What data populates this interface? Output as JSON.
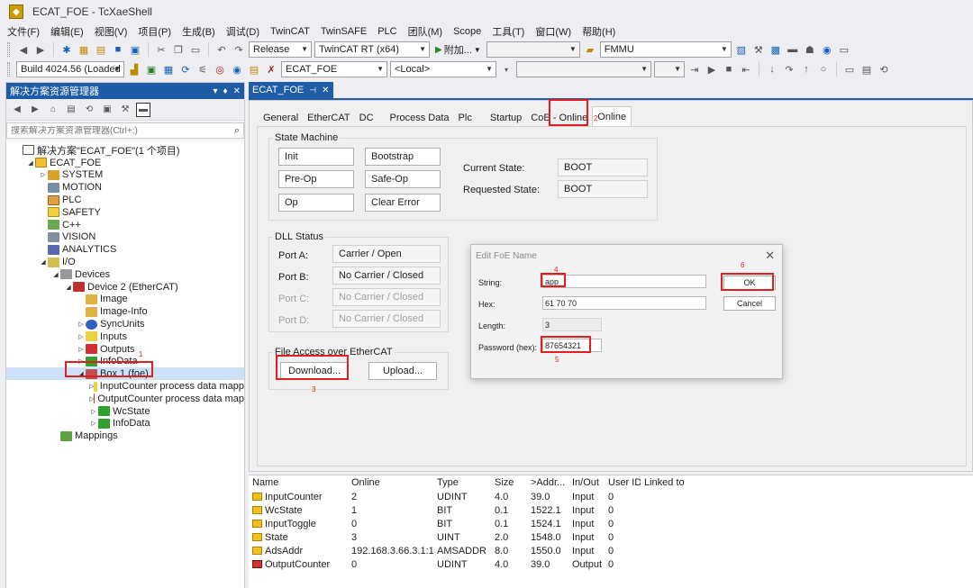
{
  "window": {
    "title": "ECAT_FOE - TcXaeShell"
  },
  "menu": [
    "文件(F)",
    "编辑(E)",
    "视图(V)",
    "项目(P)",
    "生成(B)",
    "调试(D)",
    "TwinCAT",
    "TwinSAFE",
    "PLC",
    "团队(M)",
    "Scope",
    "工具(T)",
    "窗口(W)",
    "帮助(H)"
  ],
  "toolbar1": {
    "config": "Release",
    "platform": "TwinCAT RT (x64)",
    "attach": "附加...",
    "search_combo": "FMMU"
  },
  "toolbar2": {
    "build": "Build 4024.56 (Loaded",
    "project": "ECAT_FOE",
    "target": "<Local>"
  },
  "solution_panel": {
    "title": "解决方案资源管理器",
    "search_placeholder": "搜索解决方案资源管理器(Ctrl+;)",
    "tree": [
      {
        "label": "解决方案\"ECAT_FOE\"(1 个项目)",
        "level": 0,
        "icon": "sol",
        "exp": ""
      },
      {
        "label": "ECAT_FOE",
        "level": 1,
        "icon": "proj",
        "exp": "◢"
      },
      {
        "label": "SYSTEM",
        "level": 2,
        "icon": "system",
        "exp": "▷"
      },
      {
        "label": "MOTION",
        "level": 2,
        "icon": "motion",
        "exp": ""
      },
      {
        "label": "PLC",
        "level": 2,
        "icon": "plc",
        "exp": ""
      },
      {
        "label": "SAFETY",
        "level": 2,
        "icon": "safety",
        "exp": ""
      },
      {
        "label": "C++",
        "level": 2,
        "icon": "cpp",
        "exp": ""
      },
      {
        "label": "VISION",
        "level": 2,
        "icon": "vision",
        "exp": ""
      },
      {
        "label": "ANALYTICS",
        "level": 2,
        "icon": "analytics",
        "exp": ""
      },
      {
        "label": "I/O",
        "level": 2,
        "icon": "io",
        "exp": "◢"
      },
      {
        "label": "Devices",
        "level": 3,
        "icon": "devices",
        "exp": "◢"
      },
      {
        "label": "Device 2 (EtherCAT)",
        "level": 4,
        "icon": "dev2",
        "exp": "◢"
      },
      {
        "label": "Image",
        "level": 5,
        "icon": "image",
        "exp": ""
      },
      {
        "label": "Image-Info",
        "level": 5,
        "icon": "image",
        "exp": ""
      },
      {
        "label": "SyncUnits",
        "level": 5,
        "icon": "sync",
        "exp": "▷"
      },
      {
        "label": "Inputs",
        "level": 5,
        "icon": "inputs",
        "exp": "▷"
      },
      {
        "label": "Outputs",
        "level": 5,
        "icon": "outputs",
        "exp": "▷"
      },
      {
        "label": "InfoData",
        "level": 5,
        "icon": "infodata",
        "exp": "▷"
      },
      {
        "label": "Box 1 (foe)",
        "level": 5,
        "icon": "box",
        "exp": "◢",
        "selected": true
      },
      {
        "label": "InputCounter process data mapp",
        "level": 6,
        "icon": "inputs",
        "exp": "▷"
      },
      {
        "label": "OutputCounter process data map",
        "level": 6,
        "icon": "outputs",
        "exp": "▷"
      },
      {
        "label": "WcState",
        "level": 6,
        "icon": "infodata",
        "exp": "▷"
      },
      {
        "label": "InfoData",
        "level": 6,
        "icon": "infodata",
        "exp": "▷"
      },
      {
        "label": "Mappings",
        "level": 3,
        "icon": "mappings",
        "exp": ""
      }
    ]
  },
  "doc_tab": {
    "label": "ECAT_FOE"
  },
  "prop_tabs": [
    "General",
    "EtherCAT",
    "DC",
    "Process Data",
    "Plc",
    "Startup",
    "CoE - Online",
    "Online"
  ],
  "online": {
    "state_machine": {
      "title": "State Machine",
      "buttons": [
        "Init",
        "Bootstrap",
        "Pre-Op",
        "Safe-Op",
        "Op",
        "Clear Error"
      ],
      "current_state_label": "Current State:",
      "current_state": "BOOT",
      "requested_state_label": "Requested State:",
      "requested_state": "BOOT"
    },
    "dll_status": {
      "title": "DLL Status",
      "ports": [
        {
          "label": "Port A:",
          "value": "Carrier / Open",
          "enabled": true
        },
        {
          "label": "Port B:",
          "value": "No Carrier / Closed",
          "enabled": true
        },
        {
          "label": "Port C:",
          "value": "No Carrier / Closed",
          "enabled": false
        },
        {
          "label": "Port D:",
          "value": "No Carrier / Closed",
          "enabled": false
        }
      ]
    },
    "foe": {
      "title": "File Access over EtherCAT",
      "download": "Download...",
      "upload": "Upload..."
    }
  },
  "dialog": {
    "title": "Edit FoE Name",
    "string_label": "String:",
    "string_value": "app",
    "hex_label": "Hex:",
    "hex_value": "61 70 70",
    "length_label": "Length:",
    "length_value": "3",
    "password_label": "Password (hex):",
    "password_value": "87654321",
    "ok": "OK",
    "cancel": "Cancel"
  },
  "annotations": [
    "1",
    "2",
    "3",
    "4",
    "5",
    "6"
  ],
  "grid": {
    "columns": [
      "Name",
      "Online",
      "Type",
      "Size",
      ">Addr...",
      "In/Out",
      "User ID",
      "Linked to"
    ],
    "rows": [
      {
        "name": "InputCounter",
        "online": "2",
        "type": "UDINT",
        "size": "4.0",
        "addr": "39.0",
        "inout": "Input",
        "user": "0",
        "linked": "",
        "dir": "in"
      },
      {
        "name": "WcState",
        "online": "1",
        "type": "BIT",
        "size": "0.1",
        "addr": "1522.1",
        "inout": "Input",
        "user": "0",
        "linked": "",
        "dir": "in"
      },
      {
        "name": "InputToggle",
        "online": "0",
        "type": "BIT",
        "size": "0.1",
        "addr": "1524.1",
        "inout": "Input",
        "user": "0",
        "linked": "",
        "dir": "in"
      },
      {
        "name": "State",
        "online": "3",
        "type": "UINT",
        "size": "2.0",
        "addr": "1548.0",
        "inout": "Input",
        "user": "0",
        "linked": "",
        "dir": "in"
      },
      {
        "name": "AdsAddr",
        "online": "192.168.3.66.3.1:1...",
        "type": "AMSADDR",
        "size": "8.0",
        "addr": "1550.0",
        "inout": "Input",
        "user": "0",
        "linked": "",
        "dir": "in"
      },
      {
        "name": "OutputCounter",
        "online": "0",
        "type": "UDINT",
        "size": "4.0",
        "addr": "39.0",
        "inout": "Output",
        "user": "0",
        "linked": "",
        "dir": "out"
      }
    ]
  }
}
